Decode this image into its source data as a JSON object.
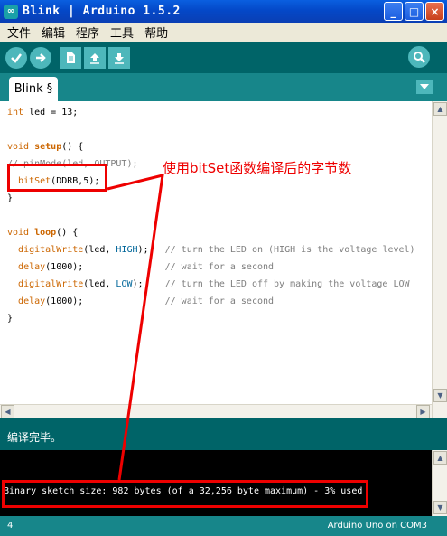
{
  "window": {
    "title": "Blink | Arduino 1.5.2",
    "icon_text": "∞",
    "buttons": {
      "minimize": "_",
      "maximize": "□",
      "close": "×"
    }
  },
  "menu": [
    "文件",
    "编辑",
    "程序",
    "工具",
    "帮助"
  ],
  "toolbar": {
    "icons": [
      "verify-check-icon",
      "upload-arrow-icon",
      "new-file-icon",
      "open-up-arrow-icon",
      "save-down-arrow-icon",
      "serial-monitor-magnifier-icon"
    ]
  },
  "tabs": [
    {
      "label": "Blink §"
    }
  ],
  "code_lines": [
    "int led = 13;",
    "",
    "void setup() {",
    "// pinMode(led, OUTPUT);",
    "  bitSet(DDRB,5);",
    "}",
    "",
    "void loop() {",
    "  digitalWrite(led, HIGH);   // turn the LED on (HIGH is the voltage level)",
    "  delay(1000);               // wait for a second",
    "  digitalWrite(led, LOW);    // turn the LED off by making the voltage LOW",
    "  delay(1000);               // wait for a second",
    "}"
  ],
  "status_message": "编译完毕。",
  "console_output": "Binary sketch size: 982 bytes (of a 32,256 byte maximum) - 3% used",
  "bottom_bar": {
    "line_number": "4",
    "board_info": "Arduino Uno on COM3"
  },
  "annotation": {
    "label": "使用bitSet函数编译后的字节数",
    "color": "#ee0000"
  },
  "colors": {
    "toolbar_bg": "#006468",
    "tab_strip_bg": "#17868a",
    "button_fill": "#4db7bb",
    "keyword": "#cc6600",
    "constant": "#006699",
    "comment": "#7e7e7e"
  }
}
